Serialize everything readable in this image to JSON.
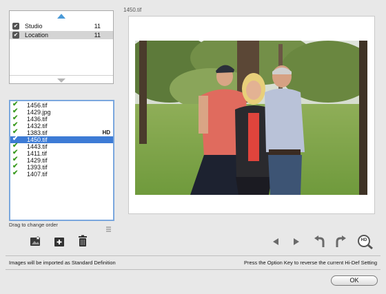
{
  "sources": {
    "rows": [
      {
        "label": "Studio",
        "count": "11"
      },
      {
        "label": "Location",
        "count": "11"
      }
    ]
  },
  "files": {
    "items": [
      {
        "name": "1456.tif",
        "badge": ""
      },
      {
        "name": "1429.jpg",
        "badge": ""
      },
      {
        "name": "1436.tif",
        "badge": ""
      },
      {
        "name": "1432.tif",
        "badge": ""
      },
      {
        "name": "1383.tif",
        "badge": "HD"
      },
      {
        "name": "1450.tif",
        "badge": ""
      },
      {
        "name": "1443.tif",
        "badge": ""
      },
      {
        "name": "1411.tif",
        "badge": ""
      },
      {
        "name": "1429.tif",
        "badge": ""
      },
      {
        "name": "1393.tif",
        "badge": ""
      },
      {
        "name": "1407.tif",
        "badge": ""
      }
    ],
    "selected_index": 5,
    "drag_hint": "Drag to change order"
  },
  "preview": {
    "title": "1450.tif"
  },
  "zoom_icon_label": "HD",
  "status": {
    "left": "Images will be imported as Standard Definition",
    "right": "Press the Option Key to reverse the current Hi-Def Setting"
  },
  "buttons": {
    "ok": "OK"
  },
  "colors": {
    "selection": "#3d7bd5",
    "check": "#3b9b22",
    "scroll_arrow": "#4a9ad8"
  }
}
